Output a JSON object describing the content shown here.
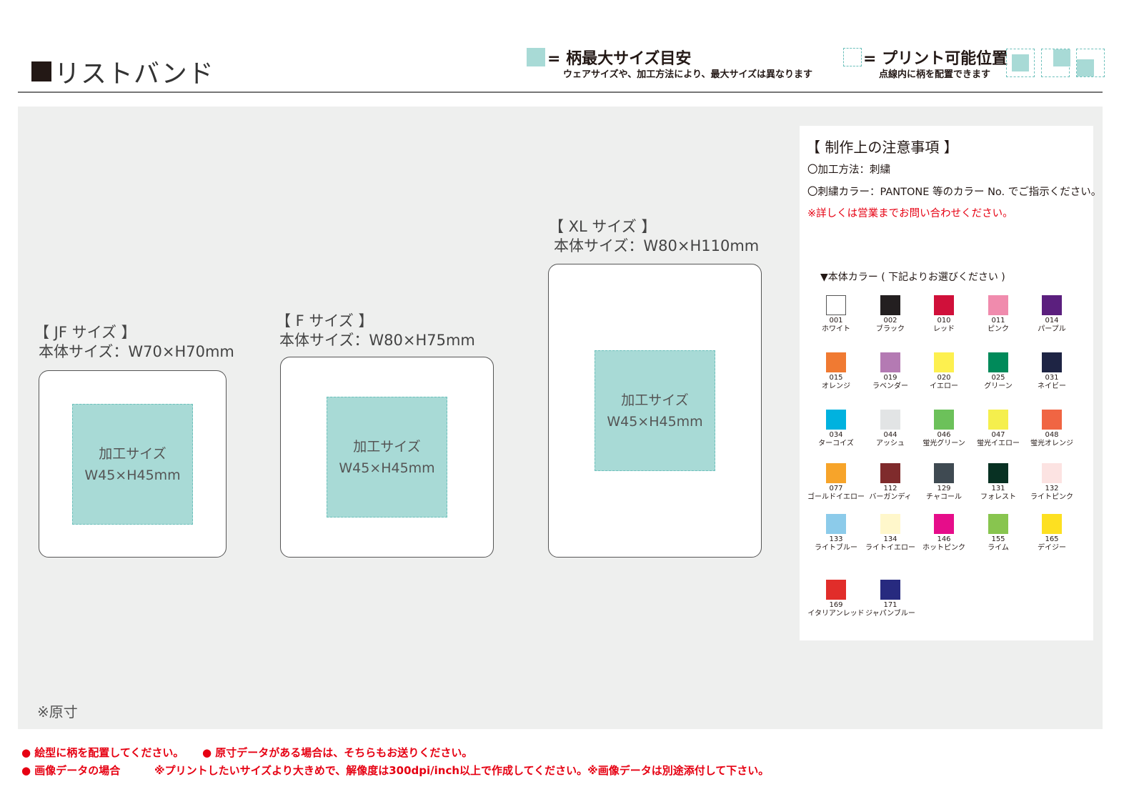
{
  "header": {
    "title": "リストバンド",
    "legend_max": {
      "label": "= 柄最大サイズ目安",
      "sub": "ウェアサイズや、加工方法により、最大サイズは異なります"
    },
    "legend_print": {
      "label": "= プリント可能位置",
      "sub": "点線内に柄を配置できます"
    }
  },
  "sizes": [
    {
      "title": "【 JF サイズ 】",
      "body": "本体サイズ：W70×H70mm",
      "area_label": "加工サイズ",
      "area_size": "W45×H45mm"
    },
    {
      "title": "【 F サイズ 】",
      "body": "本体サイズ：W80×H75mm",
      "area_label": "加工サイズ",
      "area_size": "W45×H45mm"
    },
    {
      "title": "【 XL サイズ 】",
      "body": "本体サイズ：W80×H110mm",
      "area_label": "加工サイズ",
      "area_size": "W45×H45mm"
    }
  ],
  "original_note": "※原寸",
  "notes": {
    "title": "【 制作上の注意事項 】",
    "method": "〇加工方法：刺繍",
    "color": "〇刺繍カラー：PANTONE 等のカラー No. でご指示ください。",
    "contact": "※詳しくは営業までお問い合わせください。",
    "body_color_heading": "▼本体カラー ( 下記よりお選びください )"
  },
  "body_colors": [
    {
      "code": "001",
      "name": "ホワイト",
      "hex": "#ffffff"
    },
    {
      "code": "002",
      "name": "ブラック",
      "hex": "#231f20"
    },
    {
      "code": "010",
      "name": "レッド",
      "hex": "#d0103a"
    },
    {
      "code": "011",
      "name": "ピンク",
      "hex": "#f08bad"
    },
    {
      "code": "014",
      "name": "パープル",
      "hex": "#5b1f7e"
    },
    {
      "code": "015",
      "name": "オレンジ",
      "hex": "#f07a32"
    },
    {
      "code": "019",
      "name": "ラベンダー",
      "hex": "#b47ab3"
    },
    {
      "code": "020",
      "name": "イエロー",
      "hex": "#fdf04f"
    },
    {
      "code": "025",
      "name": "グリーン",
      "hex": "#008a5a"
    },
    {
      "code": "031",
      "name": "ネイビー",
      "hex": "#1e2444"
    },
    {
      "code": "034",
      "name": "ターコイズ",
      "hex": "#00b2df"
    },
    {
      "code": "044",
      "name": "アッシュ",
      "hex": "#e2e4e5"
    },
    {
      "code": "046",
      "name": "蛍光グリーン",
      "hex": "#6cc15a"
    },
    {
      "code": "047",
      "name": "蛍光イエロー",
      "hex": "#f5ef4d"
    },
    {
      "code": "048",
      "name": "蛍光オレンジ",
      "hex": "#f06543"
    },
    {
      "code": "077",
      "name": "ゴールドイエロー",
      "hex": "#f7a42a"
    },
    {
      "code": "112",
      "name": "バーガンディ",
      "hex": "#7f2b2c"
    },
    {
      "code": "129",
      "name": "チャコール",
      "hex": "#3f4a52"
    },
    {
      "code": "131",
      "name": "フォレスト",
      "hex": "#083123"
    },
    {
      "code": "132",
      "name": "ライトピンク",
      "hex": "#fce3e2"
    },
    {
      "code": "133",
      "name": "ライトブルー",
      "hex": "#8ccbea"
    },
    {
      "code": "134",
      "name": "ライトイエロー",
      "hex": "#fff7cb"
    },
    {
      "code": "146",
      "name": "ホットピンク",
      "hex": "#e60d8a"
    },
    {
      "code": "155",
      "name": "ライム",
      "hex": "#88c54f"
    },
    {
      "code": "165",
      "name": "デイジー",
      "hex": "#fde021"
    },
    {
      "code": "169",
      "name": "イタリアンレッド",
      "hex": "#e12d2a"
    },
    {
      "code": "171",
      "name": "ジャパンブルー",
      "hex": "#272a7f"
    }
  ],
  "footer": {
    "line1a": "● 絵型に柄を配置してください。",
    "line1b": "● 原寸データがある場合は、そちらもお送りください。",
    "line2a": "● 画像データの場合",
    "line2b": "※プリントしたいサイズより大きめで、解像度は300dpi/inch以上で作成してください。※画像データは別途添付して下さい。"
  },
  "colors": {
    "accent_teal": "#a8dad6",
    "dash_teal": "#6cc0bb",
    "alert_red": "#e60012",
    "panel_gray": "#eeefee"
  }
}
